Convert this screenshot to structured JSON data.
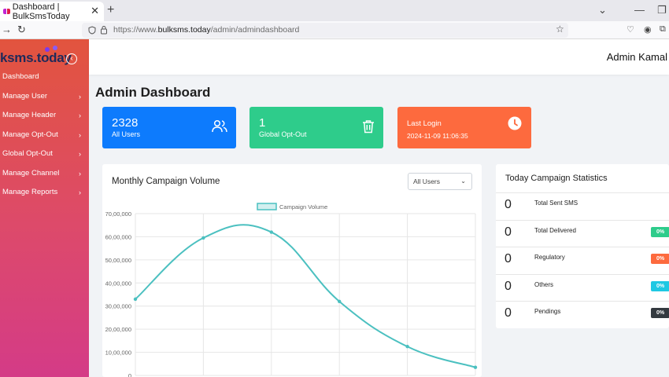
{
  "browser": {
    "tab_title": "Dashboard | BulkSmsToday",
    "url_prefix": "https://www.",
    "url_domain": "bulksms.today",
    "url_path": "/admin/admindashboard"
  },
  "sidebar": {
    "logo": "ksms.today",
    "items": [
      {
        "label": "Dashboard"
      },
      {
        "label": "Manage User"
      },
      {
        "label": "Manage Header"
      },
      {
        "label": "Manage Opt-Out"
      },
      {
        "label": "Global Opt-Out"
      },
      {
        "label": "Manage Channel"
      },
      {
        "label": "Manage Reports"
      }
    ]
  },
  "header": {
    "admin_name": "Admin Kamal"
  },
  "page": {
    "title": "Admin Dashboard"
  },
  "cards": {
    "users": {
      "value": "2328",
      "label": "All Users"
    },
    "optout": {
      "value": "1",
      "label": "Global Opt-Out"
    },
    "login": {
      "label": "Last Login",
      "value": "2024-11-09 11:06:35"
    }
  },
  "chart": {
    "title": "Monthly Campaign Volume",
    "filter_selected": "All Users"
  },
  "chart_data": {
    "type": "line",
    "series": [
      {
        "name": "Campaign Volume",
        "values": [
          3300000,
          5950000,
          6200000,
          3200000,
          1250000,
          350000
        ]
      }
    ],
    "yticks": [
      "0",
      "10,00,000",
      "20,00,000",
      "30,00,000",
      "40,00,000",
      "50,00,000",
      "60,00,000",
      "70,00,000"
    ],
    "ylim": [
      0,
      7000000
    ],
    "grid": true,
    "legend": "top",
    "color": "#4bc0c0"
  },
  "today": {
    "title": "Today Campaign Statistics",
    "rows": [
      {
        "value": "0",
        "label": "Total Sent SMS"
      },
      {
        "value": "0",
        "label": "Total Delivered",
        "badge": "0%"
      },
      {
        "value": "0",
        "label": "Regulatory",
        "badge": "0%"
      },
      {
        "value": "0",
        "label": "Others",
        "badge": "0%"
      },
      {
        "value": "0",
        "label": "Pendings",
        "badge": "0%"
      }
    ]
  },
  "colors": {
    "blue": "#0d7bfd",
    "green": "#2ecc8b",
    "orange": "#fd6a3e",
    "cyan": "#1fc8e3",
    "dark": "#343a40"
  }
}
